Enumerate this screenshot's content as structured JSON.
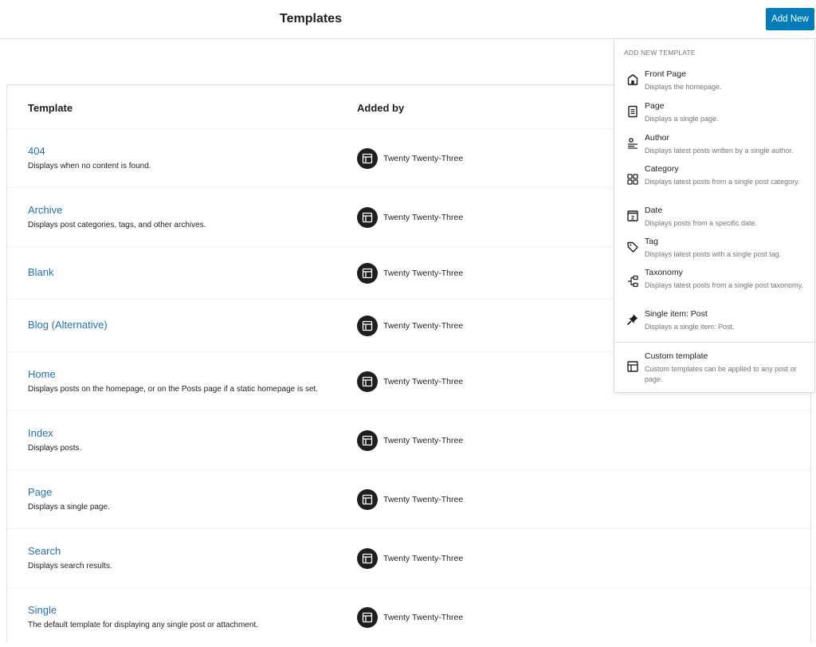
{
  "header": {
    "title": "Templates",
    "add_new_label": "Add New"
  },
  "table": {
    "columns": {
      "template": "Template",
      "added_by": "Added by"
    },
    "rows": [
      {
        "title": "404",
        "description": "Displays when no content is found.",
        "author": "Twenty Twenty-Three"
      },
      {
        "title": "Archive",
        "description": "Displays post categories, tags, and other archives.",
        "author": "Twenty Twenty-Three"
      },
      {
        "title": "Blank",
        "description": "",
        "author": "Twenty Twenty-Three"
      },
      {
        "title": "Blog (Alternative)",
        "description": "",
        "author": "Twenty Twenty-Three"
      },
      {
        "title": "Home",
        "description": "Displays posts on the homepage, or on the Posts page if a static homepage is set.",
        "author": "Twenty Twenty-Three"
      },
      {
        "title": "Index",
        "description": "Displays posts.",
        "author": "Twenty Twenty-Three"
      },
      {
        "title": "Page",
        "description": "Displays a single page.",
        "author": "Twenty Twenty-Three"
      },
      {
        "title": "Search",
        "description": "Displays search results.",
        "author": "Twenty Twenty-Three"
      },
      {
        "title": "Single",
        "description": "The default template for displaying any single post or attachment.",
        "author": "Twenty Twenty-Three"
      }
    ]
  },
  "dropdown": {
    "heading": "ADD NEW TEMPLATE",
    "items": [
      {
        "label": "Front Page",
        "description": "Displays the homepage.",
        "icon": "home-icon"
      },
      {
        "label": "Page",
        "description": "Displays a single page.",
        "icon": "page-icon"
      },
      {
        "label": "Author",
        "description": "Displays latest posts written by a single author.",
        "icon": "author-icon"
      },
      {
        "label": "Category",
        "description": "Displays latest posts from a single post category.",
        "icon": "category-icon"
      },
      {
        "label": "Date",
        "description": "Displays posts from a specific date.",
        "icon": "calendar-icon",
        "icon_text": "2"
      },
      {
        "label": "Tag",
        "description": "Displays latest posts with a single post tag.",
        "icon": "tag-icon"
      },
      {
        "label": "Taxonomy",
        "description": "Displays latest posts from a single post taxonomy.",
        "icon": "taxonomy-icon"
      },
      {
        "label": "Single item: Post",
        "description": "Displays a single item: Post.",
        "icon": "pin-icon"
      },
      {
        "label": "Custom template",
        "description": "Custom templates can be applied to any post or page.",
        "icon": "layout-icon"
      }
    ]
  },
  "colors": {
    "accent": "#007cba",
    "link": "#2271b1",
    "text": "#1e1e1e",
    "muted": "#757575"
  }
}
